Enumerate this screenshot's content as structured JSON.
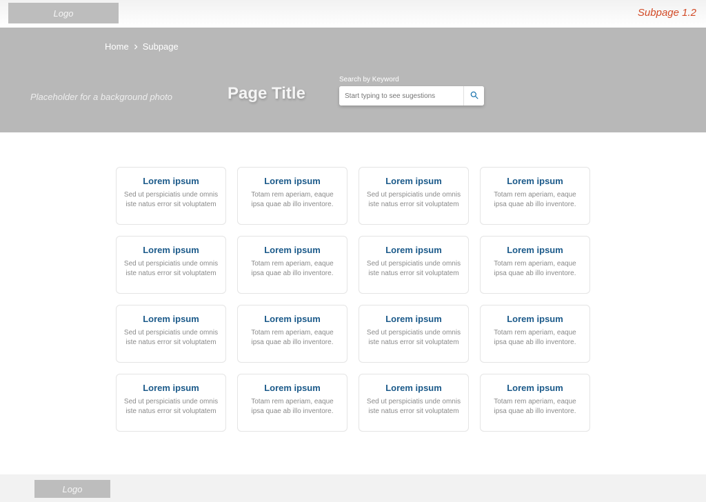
{
  "topbar": {
    "logo_text": "Logo",
    "version_label": "Subpage 1.2"
  },
  "hero": {
    "breadcrumb": {
      "home": "Home",
      "current": "Subpage"
    },
    "bg_placeholder": "Placeholder for a background photo",
    "page_title": "Page Title",
    "search_label": "Search by Keyword",
    "search_placeholder": "Start typing to see sugestions"
  },
  "cards": [
    {
      "title": "Lorem ipsum",
      "body": "Sed ut perspiciatis unde omnis iste natus error sit voluptatem"
    },
    {
      "title": "Lorem ipsum",
      "body": "Totam rem aperiam, eaque ipsa quae ab illo inventore."
    },
    {
      "title": "Lorem ipsum",
      "body": "Sed ut perspiciatis unde omnis iste natus error sit voluptatem"
    },
    {
      "title": "Lorem ipsum",
      "body": "Totam rem aperiam, eaque ipsa quae ab illo inventore."
    },
    {
      "title": "Lorem ipsum",
      "body": "Sed ut perspiciatis unde omnis iste natus error sit voluptatem"
    },
    {
      "title": "Lorem ipsum",
      "body": "Totam rem aperiam, eaque ipsa quae ab illo inventore."
    },
    {
      "title": "Lorem ipsum",
      "body": "Sed ut perspiciatis unde omnis iste natus error sit voluptatem"
    },
    {
      "title": "Lorem ipsum",
      "body": "Totam rem aperiam, eaque ipsa quae ab illo inventore."
    },
    {
      "title": "Lorem ipsum",
      "body": "Sed ut perspiciatis unde omnis iste natus error sit voluptatem"
    },
    {
      "title": "Lorem ipsum",
      "body": "Totam rem aperiam, eaque ipsa quae ab illo inventore."
    },
    {
      "title": "Lorem ipsum",
      "body": "Sed ut perspiciatis unde omnis iste natus error sit voluptatem"
    },
    {
      "title": "Lorem ipsum",
      "body": "Totam rem aperiam, eaque ipsa quae ab illo inventore."
    },
    {
      "title": "Lorem ipsum",
      "body": "Sed ut perspiciatis unde omnis iste natus error sit voluptatem"
    },
    {
      "title": "Lorem ipsum",
      "body": "Totam rem aperiam, eaque ipsa quae ab illo inventore."
    },
    {
      "title": "Lorem ipsum",
      "body": "Sed ut perspiciatis unde omnis iste natus error sit voluptatem"
    },
    {
      "title": "Lorem ipsum",
      "body": "Totam rem aperiam, eaque ipsa quae ab illo inventore."
    }
  ],
  "footer": {
    "logo_text": "Logo"
  }
}
